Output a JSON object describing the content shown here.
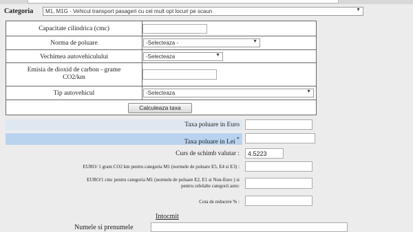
{
  "categorie": {
    "label": "Categoria",
    "selected": "M1, M1G - Vehicul transport pasageri cu cel mult opt locuri pe scaun"
  },
  "form": {
    "capacitate_label": "Capacitate cilindrica (cmc)",
    "capacitate_value": "",
    "norma_label": "Norma de poluare",
    "norma_selected": "-Selecteaza -",
    "vechime_label": "Vechimea autovehiculului",
    "vechime_selected": "-Selecteaza",
    "emisia_label": "Emisia de dioxid de carbon  - grame CO2/km",
    "emisia_value": "",
    "tip_label": "Tip autovehicul",
    "tip_selected": "-Selecteaza",
    "calc_button": "Calculeaza taxa"
  },
  "results": {
    "taxa_euro_label": "Taxa poluare in Euro",
    "taxa_euro_value": "",
    "taxa_lei_label": "Taxa poluare in Lei",
    "taxa_lei_marker": "*",
    "taxa_lei_value": "",
    "curs_label": "Curs de schimb valutar :",
    "curs_value": "4.5223",
    "euro_co2_label": "EURO/ 1 gram CO2 km pentru categoria M1 (normele de poluare E5, E4 si E3) :",
    "euro_co2_value": "",
    "euro_cmc_label": "EURO/1 cmc pentru categoria M1 (normele de poluare E2, E1 si Non-Euro ) si pentru celelalte categorii auto:",
    "euro_cmc_value": "",
    "cota_label": "Cota de reducere % :",
    "cota_value": ""
  },
  "footer": {
    "intocmit": "Intocmit",
    "nume_label": "Numele si prenumele"
  }
}
